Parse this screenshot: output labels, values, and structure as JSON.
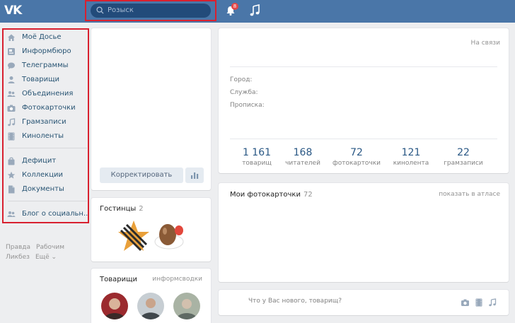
{
  "topbar": {
    "logo": "VK",
    "search_placeholder": "Розыск",
    "notifications_badge": "8"
  },
  "leftnav": {
    "items": [
      {
        "label": "Моё Досье",
        "icon": "home-icon"
      },
      {
        "label": "Информбюро",
        "icon": "news-icon"
      },
      {
        "label": "Телеграммы",
        "icon": "messages-icon"
      },
      {
        "label": "Товарищи",
        "icon": "user-icon"
      },
      {
        "label": "Объединения",
        "icon": "groups-icon"
      },
      {
        "label": "Фотокарточки",
        "icon": "camera-icon"
      },
      {
        "label": "Грамзаписи",
        "icon": "music-note-icon"
      },
      {
        "label": "Киноленты",
        "icon": "film-icon"
      },
      {
        "label": "Дефицит",
        "icon": "bag-icon"
      },
      {
        "label": "Коллекции",
        "icon": "star-icon"
      },
      {
        "label": "Документы",
        "icon": "document-icon"
      },
      {
        "label": "Блог о социальн..",
        "icon": "groups-icon"
      }
    ]
  },
  "footer": {
    "links_row1": [
      "Правда",
      "Рабочим"
    ],
    "links_row2": [
      "Ликбез",
      "Ещё ⌄"
    ]
  },
  "profile": {
    "edit_button": "Корректировать"
  },
  "gifts": {
    "title": "Гостинцы",
    "count": "2"
  },
  "friends": {
    "title": "Товарищи",
    "tab": "информсводки"
  },
  "info": {
    "status": "На связи",
    "fields": [
      "Город:",
      "Служба:",
      "Прописка:"
    ],
    "counters": [
      {
        "value": "1 161",
        "label": "товарищ"
      },
      {
        "value": "168",
        "label": "читателей"
      },
      {
        "value": "72",
        "label": "фотокарточки"
      },
      {
        "value": "121",
        "label": "кинолента"
      },
      {
        "value": "22",
        "label": "грамзаписи"
      }
    ]
  },
  "photos": {
    "title": "Мои фотокарточки",
    "count": "72",
    "link": "показать в атласе"
  },
  "post": {
    "placeholder": "Что у Вас нового, товарищ?"
  },
  "colors": {
    "header": "#4a76a8",
    "highlight": "#d8202f",
    "link": "#285473"
  }
}
